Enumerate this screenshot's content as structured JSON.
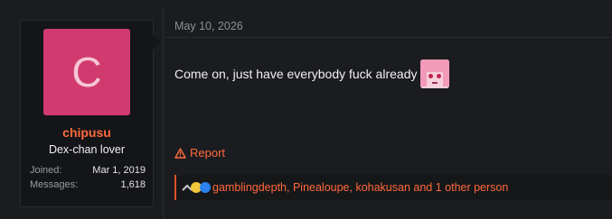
{
  "post": {
    "date": "May 10, 2026",
    "body": "Come on, just have everybody fuck already",
    "report_label": "Report",
    "reactions_text": "gamblingdepth, Pinealoupe, kohakusan and 1 other person"
  },
  "user": {
    "avatar_letter": "C",
    "username": "chipusu",
    "title": "Dex-chan lover",
    "joined_label": "Joined:",
    "joined_value": "Mar 1, 2019",
    "messages_label": "Messages:",
    "messages_value": "1,618"
  },
  "colors": {
    "accent": "#ff6a3d",
    "avatar_bg": "#d13a6e",
    "background": "#1b1c1f"
  },
  "icons": {
    "emote": "anime-girl-emote",
    "reactions": [
      "chevron-up-icon",
      "grin-emoji-icon",
      "thumbs-up-icon"
    ],
    "report": "warning-triangle-icon"
  }
}
